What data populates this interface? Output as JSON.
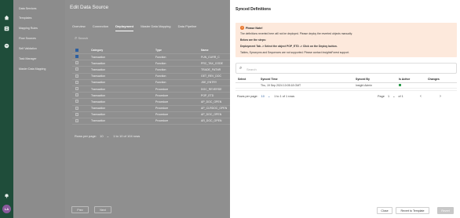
{
  "rail": {
    "icons": [
      "home-icon",
      "list-icon",
      "chat-icon"
    ],
    "bottom_icon": "bell-icon",
    "avatar_initials": "LA"
  },
  "sidebar": {
    "items": [
      {
        "label": "Data Services"
      },
      {
        "label": "Templates"
      },
      {
        "label": "Mapping Rules"
      },
      {
        "label": "Flow Sources"
      },
      {
        "label": "Self Validation"
      },
      {
        "label": "Task Manager"
      },
      {
        "label": "Master Data Mapping"
      }
    ]
  },
  "main": {
    "title": "Edit Data Source",
    "tabs": [
      {
        "label": "Overview",
        "active": false
      },
      {
        "label": "Connection",
        "active": false
      },
      {
        "label": "Deployment",
        "active": true
      },
      {
        "label": "Master Data Mapping",
        "active": false
      },
      {
        "label": "Data Pipeline",
        "active": false
      }
    ],
    "search_placeholder": "Search",
    "columns": [
      "Category",
      "Type",
      "Name"
    ],
    "rows": [
      {
        "checked": true,
        "category": "Transaction",
        "type": "Function",
        "name": "FUN_CURR_C"
      },
      {
        "checked": false,
        "category": "Transaction",
        "type": "Function",
        "name": "PRC_TAX_CODE"
      },
      {
        "checked": false,
        "category": "Transaction",
        "type": "Function",
        "name": "TRADE_PATNR"
      },
      {
        "checked": false,
        "category": "Transaction",
        "type": "Function",
        "name": "GET_REV_DOC"
      },
      {
        "checked": false,
        "category": "Transaction",
        "type": "Function",
        "name": "JSE_ENTRY"
      },
      {
        "checked": false,
        "category": "Transaction",
        "type": "Procedure",
        "name": "DOC_REVERSE"
      },
      {
        "checked": false,
        "category": "Transaction",
        "type": "Procedure",
        "name": "POP_ETD"
      },
      {
        "checked": false,
        "category": "Transaction",
        "type": "Procedure",
        "name": "AP_DOC_OPEN"
      },
      {
        "checked": false,
        "category": "Transaction",
        "type": "Procedure",
        "name": "AP_CLRDOC_OPEN"
      },
      {
        "checked": false,
        "category": "Transaction",
        "type": "Procedure",
        "name": "AP_DOC_OPEN"
      },
      {
        "checked": false,
        "category": "Transaction",
        "type": "Procedure",
        "name": "AR_DOC_OPEN"
      }
    ],
    "pager": {
      "rows_label": "Rows per page:",
      "rows_value": "10",
      "range": "1 to 10 of 104 rows"
    },
    "prev_label": "Prev",
    "next_label": "Next"
  },
  "modal": {
    "title": "Synced Definitions",
    "note": {
      "heading": "Please Note!",
      "line1": "The definitions reverted here will not be deployed. Please deploy the reverted objects manually.",
      "line2": "Below are the steps:",
      "line3": "Deployment Tab -> Select the object POP_ETD -> Click on the Deploy button.",
      "line4": "Tables, Synonyms and Sequences are not supported. Please contact InsightsForest support."
    },
    "search_placeholder": "Search",
    "columns": [
      "Select",
      "Synced Time",
      "Synced By",
      "Is Active",
      "Changes"
    ],
    "rows": [
      {
        "select": "",
        "synced_time": "Thu, 19 Sep 2024 10:05:18 GMT",
        "synced_by": "Insight Admin",
        "is_active": true,
        "changes": ""
      }
    ],
    "pager": {
      "rows_label": "Rows per page:",
      "rows_value": "10",
      "range": "1 to 1 of 1 rows",
      "page_label": "Page",
      "page_value": "1",
      "of_label": "of 1"
    },
    "buttons": {
      "close": "Close",
      "revert": "Revert to Template",
      "revert_primary": "Revert"
    },
    "colors": {
      "note_bg": "#fde9dc",
      "warn": "#e97a33",
      "active": "#2e9b4d"
    }
  }
}
